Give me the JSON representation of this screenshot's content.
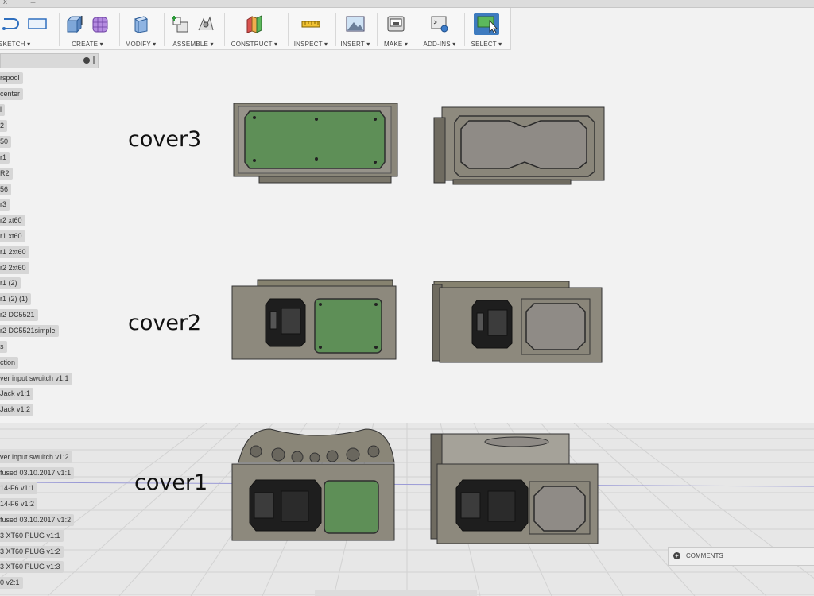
{
  "tabstrip": {
    "close": "x",
    "new_tab": "+"
  },
  "toolbar": {
    "groups": [
      {
        "label": "SKETCH ▾",
        "icons": [
          "sketch-arc-icon",
          "rectangle-icon"
        ]
      },
      {
        "label": "CREATE ▾",
        "icons": [
          "extrude-box-icon",
          "form-icon"
        ]
      },
      {
        "label": "MODIFY ▾",
        "icons": [
          "press-pull-icon"
        ]
      },
      {
        "label": "ASSEMBLE ▾",
        "icons": [
          "new-component-icon",
          "joint-icon"
        ]
      },
      {
        "label": "CONSTRUCT ▾",
        "icons": [
          "plane-icon"
        ]
      },
      {
        "label": "INSPECT ▾",
        "icons": [
          "measure-icon"
        ]
      },
      {
        "label": "INSERT ▾",
        "icons": [
          "insert-image-icon"
        ]
      },
      {
        "label": "MAKE ▾",
        "icons": [
          "print-3d-icon"
        ]
      },
      {
        "label": "ADD-INS ▾",
        "icons": [
          "scripts-icon"
        ]
      },
      {
        "label": "SELECT ▾",
        "icons": [
          "select-cursor-icon"
        ]
      }
    ]
  },
  "browser": {
    "items": [
      "rspool",
      "center",
      "l",
      "2",
      "50",
      "r1",
      "R2",
      "56",
      "r3",
      "r2 xt60",
      "r1 xt60",
      "r1 2xt60",
      "r2 2xt60",
      "r1 (2)",
      "r1 (2) (1)",
      "r2 DC5521",
      "r2 DC5521simple",
      "s",
      "ction",
      "ver input swuitch v1:1",
      "Jack v1:1",
      "Jack v1:2",
      "ver input swuitch v1:2",
      "fused 03.10.2017 v1:1",
      "14-F6 v1:1",
      "14-F6 v1:2",
      "fused 03.10.2017 v1:2",
      "3 XT60 PLUG v1:1",
      "3 XT60 PLUG v1:2",
      "3 XT60 PLUG v1:3",
      "0 v2:1"
    ]
  },
  "viewport": {
    "labels": {
      "cover3": "cover3",
      "cover2": "cover2",
      "cover1": "cover1"
    },
    "colors": {
      "body": "#8a8678",
      "panel": "#5e8f57",
      "outline": "#333333",
      "ground": "#e7e7e7"
    }
  },
  "comments": {
    "label": "COMMENTS"
  }
}
